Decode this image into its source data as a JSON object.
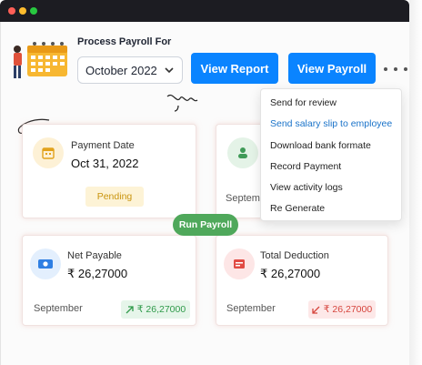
{
  "window": {
    "dots": [
      "#ff5f57",
      "#febc2e",
      "#28c840"
    ]
  },
  "header": {
    "process_label": "Process Payroll For",
    "month_value": "October 2022",
    "view_report_label": "View Report",
    "view_payroll_label": "View Payroll"
  },
  "menu": {
    "items": [
      {
        "label": "Send for review"
      },
      {
        "label": "Send salary slip to employee"
      },
      {
        "label": "Download bank formate"
      },
      {
        "label": "Record Payment"
      },
      {
        "label": "View activity logs"
      },
      {
        "label": "Re Generate"
      }
    ]
  },
  "cards": {
    "payment_date": {
      "label": "Payment Date",
      "value": "Oct 31, 2022",
      "status": "Pending",
      "icon": "calendar-icon"
    },
    "employees": {
      "footer": "Septem",
      "icon": "people-icon"
    },
    "net_payable": {
      "label": "Net Payable",
      "value": "₹ 26,27000",
      "footer": "September",
      "change": "₹ 26,27000",
      "icon": "money-icon"
    },
    "total_deduction": {
      "label": "Total Deduction",
      "value": "₹ 26,27000",
      "footer": "September",
      "change": "₹ 26,27000",
      "icon": "deduction-icon"
    }
  },
  "run_payroll_label": "Run Payroll",
  "colors": {
    "primary": "#0a84ff",
    "run_green": "#4fa85b",
    "pending_bg": "#fdf3d6",
    "pending_text": "#c9940e",
    "up_bg": "#e6f5ea",
    "up_text": "#2f9a4a",
    "down_bg": "#fde8e8",
    "down_text": "#d6453d"
  }
}
